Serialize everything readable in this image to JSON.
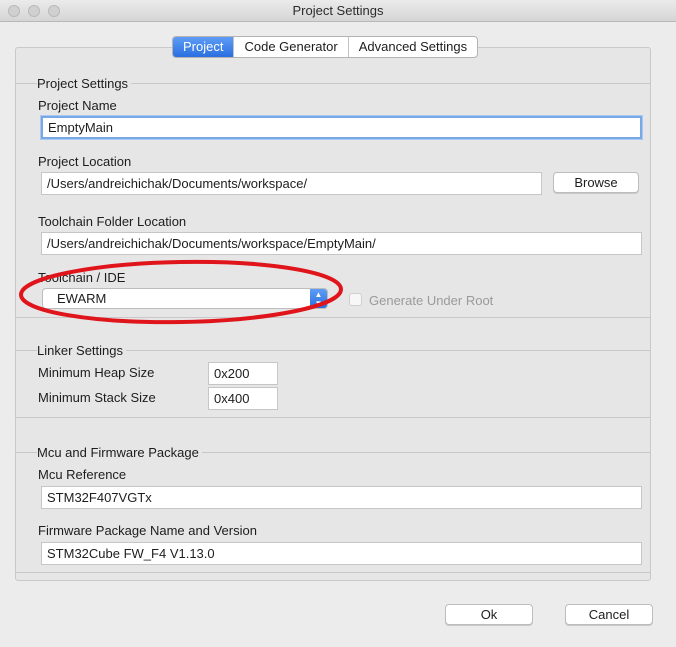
{
  "window": {
    "title": "Project Settings"
  },
  "tabs": [
    {
      "label": "Project",
      "active": true
    },
    {
      "label": "Code Generator",
      "active": false
    },
    {
      "label": "Advanced Settings",
      "active": false
    }
  ],
  "project_settings": {
    "group_title": "Project Settings",
    "project_name": {
      "label": "Project Name",
      "value": "EmptyMain"
    },
    "project_location": {
      "label": "Project Location",
      "value": "/Users/andreichichak/Documents/workspace/",
      "browse_label": "Browse"
    },
    "toolchain_folder": {
      "label": "Toolchain Folder Location",
      "value": "/Users/andreichichak/Documents/workspace/EmptyMain/"
    },
    "toolchain_ide": {
      "label": "Toolchain / IDE",
      "selected": "EWARM"
    },
    "generate_under_root": {
      "label": "Generate Under Root",
      "checked": false,
      "enabled": false
    }
  },
  "linker_settings": {
    "group_title": "Linker Settings",
    "min_heap": {
      "label": "Minimum Heap Size",
      "value": "0x200"
    },
    "min_stack": {
      "label": "Minimum Stack Size",
      "value": "0x400"
    }
  },
  "mcu_firmware": {
    "group_title": "Mcu and Firmware Package",
    "mcu_reference": {
      "label": "Mcu Reference",
      "value": "STM32F407VGTx"
    },
    "firmware_package": {
      "label": "Firmware Package Name and Version",
      "value": "STM32Cube FW_F4 V1.13.0"
    }
  },
  "footer": {
    "ok_label": "Ok",
    "cancel_label": "Cancel"
  },
  "colors": {
    "accent": "#2a6fe0",
    "annotation": "#e0141b"
  }
}
